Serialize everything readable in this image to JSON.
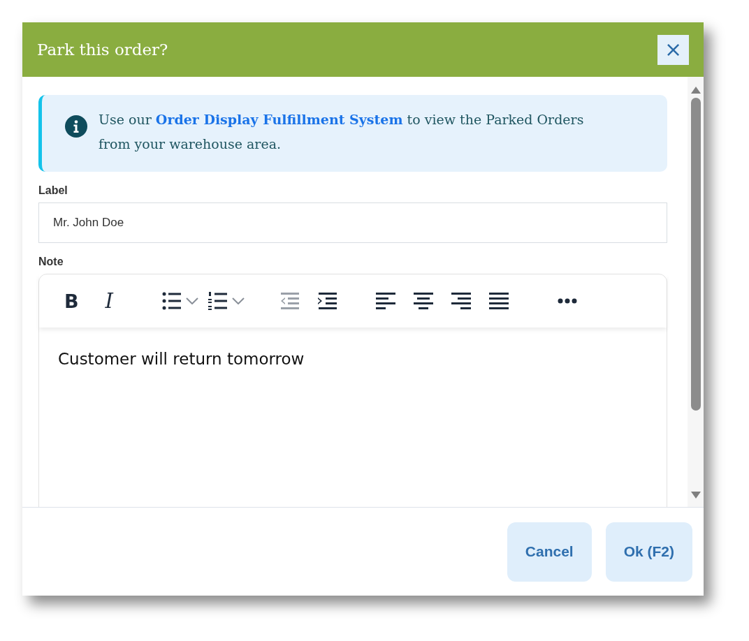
{
  "dialog": {
    "title": "Park this order?",
    "close_label": "×"
  },
  "info": {
    "text_before": "Use our ",
    "link": "Order Display Fulfillment System",
    "text_after": " to view the Parked Orders from your warehouse area."
  },
  "label_field": {
    "label": "Label",
    "value": "Mr. John Doe"
  },
  "note": {
    "label": "Note",
    "value": "Customer will return tomorrow",
    "toolbar": [
      {
        "kind": "bold",
        "label": "B",
        "disabled": false
      },
      {
        "kind": "italic",
        "label": "I",
        "disabled": false
      },
      {
        "kind": "bullet-list",
        "disabled": false
      },
      {
        "kind": "caret",
        "disabled": false
      },
      {
        "kind": "numbered-list",
        "disabled": false
      },
      {
        "kind": "caret",
        "disabled": false
      },
      {
        "kind": "outdent",
        "disabled": true
      },
      {
        "kind": "indent",
        "disabled": false
      },
      {
        "kind": "align-left",
        "disabled": false
      },
      {
        "kind": "align-center",
        "disabled": false
      },
      {
        "kind": "align-right",
        "disabled": false
      },
      {
        "kind": "justify",
        "disabled": false
      },
      {
        "kind": "more",
        "disabled": false
      }
    ]
  },
  "buttons": [
    {
      "label": "Cancel"
    },
    {
      "label": "Ok (F2)"
    }
  ]
}
